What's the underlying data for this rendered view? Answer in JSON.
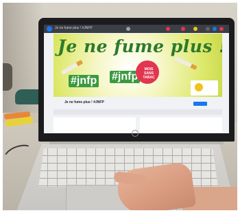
{
  "photo": {
    "description_free": true,
    "screen": {
      "tab_title": "Je ne fume plus ! #JNFP",
      "banner": {
        "title": "Je ne fume plus !",
        "hashtags": [
          "#jnfp",
          "#jnfp"
        ],
        "badge": "MOIS SANS TABAC"
      },
      "page_name": "Je ne fume plus ! #JNFP",
      "colors": {
        "facebook_blue": "#1877f2",
        "banner_green": "#2d7a2c",
        "badge_red": "#e2354f",
        "banner_yellow": "#dde86a"
      }
    },
    "laptop_brand_icon": "hp-logo-icon"
  }
}
